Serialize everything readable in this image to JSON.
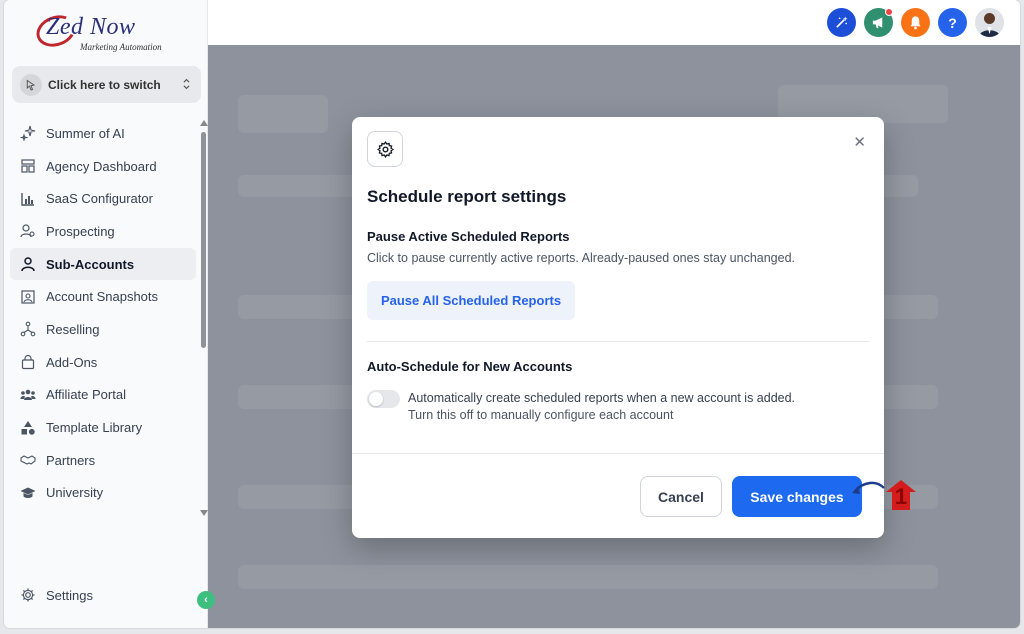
{
  "brand": {
    "name": "Zed Now",
    "tagline": "Marketing Automation"
  },
  "switcher": {
    "label": "Click here to switch"
  },
  "sidebar": {
    "items": [
      {
        "label": "Summer of AI",
        "icon": "sparkle-icon"
      },
      {
        "label": "Agency Dashboard",
        "icon": "dashboard-icon"
      },
      {
        "label": "SaaS Configurator",
        "icon": "bar-chart-icon"
      },
      {
        "label": "Prospecting",
        "icon": "user-search-icon"
      },
      {
        "label": "Sub-Accounts",
        "icon": "user-icon",
        "active": true
      },
      {
        "label": "Account Snapshots",
        "icon": "snapshot-icon"
      },
      {
        "label": "Reselling",
        "icon": "network-icon"
      },
      {
        "label": "Add-Ons",
        "icon": "bag-icon"
      },
      {
        "label": "Affiliate Portal",
        "icon": "users-icon"
      },
      {
        "label": "Template Library",
        "icon": "shapes-icon"
      },
      {
        "label": "Partners",
        "icon": "handshake-icon"
      },
      {
        "label": "University",
        "icon": "graduation-cap-icon"
      }
    ],
    "settings_label": "Settings"
  },
  "header": {
    "buttons": [
      {
        "name": "magic-wand-icon",
        "color": "#1d4ed8"
      },
      {
        "name": "megaphone-icon",
        "color": "#2f8f6f",
        "badge": true
      },
      {
        "name": "bell-icon",
        "color": "#f97316"
      },
      {
        "name": "help-icon",
        "color": "#2563eb",
        "text": "?"
      }
    ]
  },
  "modal": {
    "title": "Schedule report settings",
    "section1": {
      "title": "Pause Active Scheduled Reports",
      "description": "Click to pause currently active reports. Already-paused ones stay unchanged.",
      "button": "Pause All Scheduled Reports"
    },
    "section2": {
      "title": "Auto-Schedule for New Accounts",
      "toggle_on": false,
      "toggle_line1": "Automatically create scheduled reports when a new account is added.",
      "toggle_line2": "Turn this off to manually configure each account"
    },
    "cancel_label": "Cancel",
    "save_label": "Save changes"
  },
  "annotation": {
    "number": "1",
    "color": "#d31c1c"
  }
}
